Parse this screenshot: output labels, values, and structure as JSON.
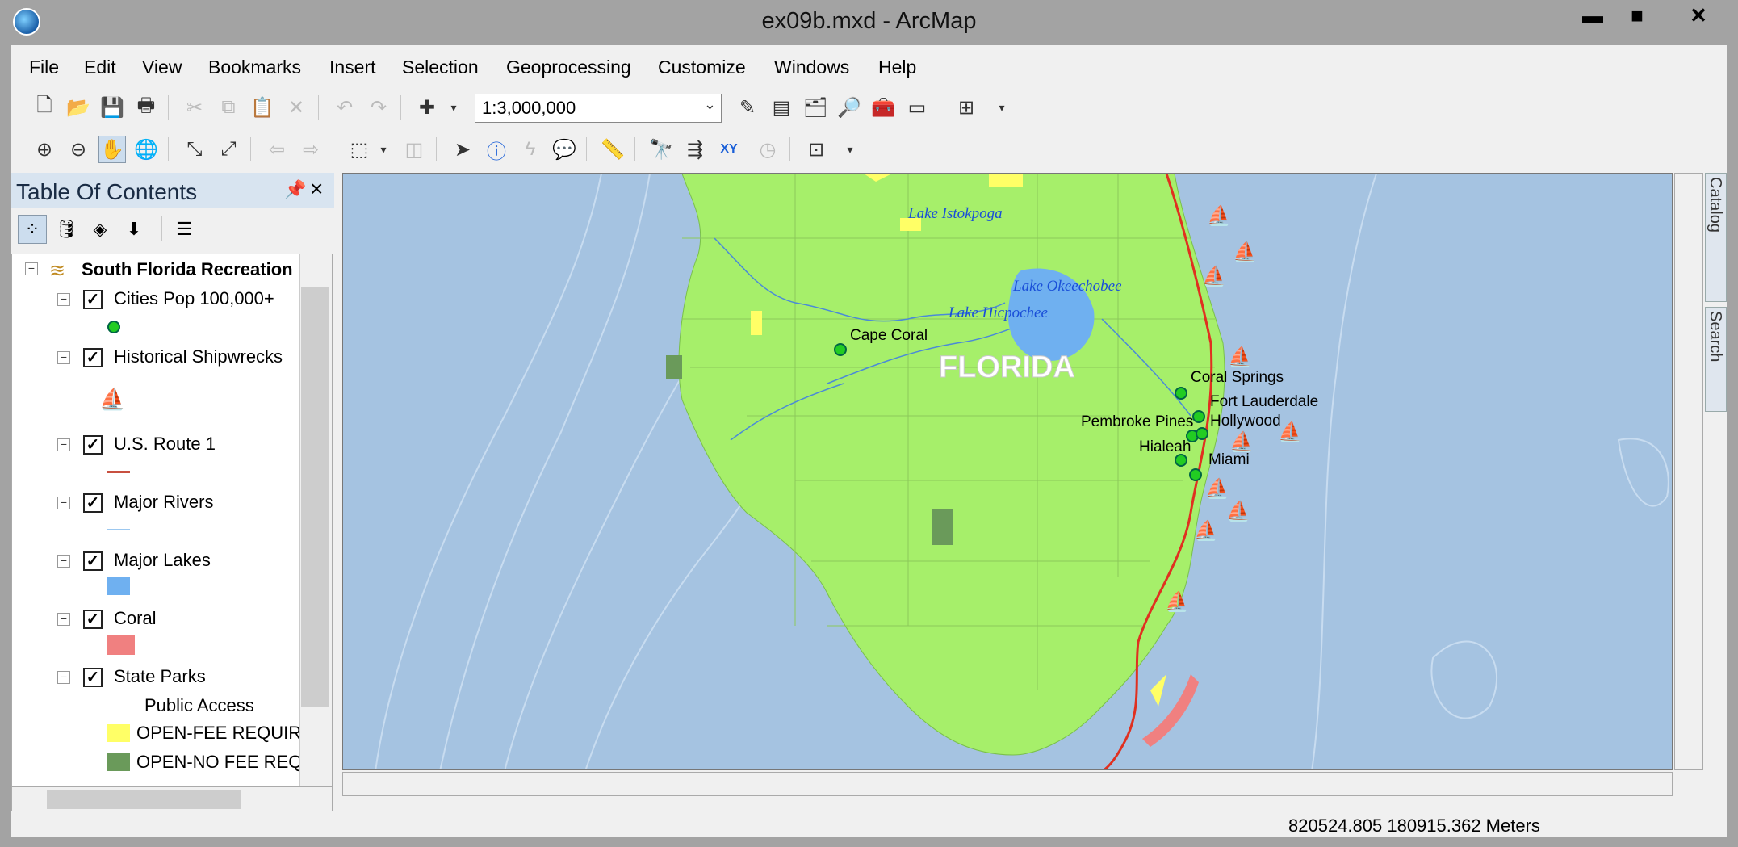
{
  "window": {
    "title": "ex09b.mxd - ArcMap",
    "minimize": "▬",
    "maximize": "■",
    "close": "✕"
  },
  "menu": [
    "File",
    "Edit",
    "View",
    "Bookmarks",
    "Insert",
    "Selection",
    "Geoprocessing",
    "Customize",
    "Windows",
    "Help"
  ],
  "toolbar": {
    "scale": "1:3,000,000"
  },
  "toc": {
    "title": "Table Of Contents",
    "root": "South Florida Recreation",
    "layers": [
      {
        "name": "Cities Pop 100,000+"
      },
      {
        "name": "Historical Shipwrecks"
      },
      {
        "name": "U.S. Route 1"
      },
      {
        "name": "Major Rivers"
      },
      {
        "name": "Major Lakes"
      },
      {
        "name": "Coral"
      },
      {
        "name": "State Parks"
      }
    ],
    "state_parks_field": "Public Access",
    "state_parks_classes": [
      "OPEN-FEE REQUIRE",
      "OPEN-NO FEE REQU"
    ]
  },
  "map": {
    "state_label": "FLORIDA",
    "lakes": [
      "Lake Istokpoga",
      "Lake Okeechobee",
      "Lake Hicpochee"
    ],
    "cities": [
      "Cape Coral",
      "Coral Springs",
      "Fort Lauderdale",
      "Pembroke Pines",
      "Hollywood",
      "Hialeah",
      "Miami"
    ]
  },
  "side_tabs": [
    "Catalog",
    "Search"
  ],
  "status": {
    "coordinates": "820524.805  180915.362 Meters"
  },
  "colors": {
    "land": "#a6ef6a",
    "water": "#a5c3e1",
    "lake": "#6fb0f0",
    "route": "#e03020",
    "coral": "#f08080",
    "park_fee": "#ffff66",
    "park_nofee": "#6a9a5a",
    "city": "#22aa22"
  },
  "icons": [
    "new-icon",
    "open-icon",
    "save-icon",
    "print-icon",
    "cut-icon",
    "copy-icon",
    "paste-icon",
    "delete-icon",
    "undo-icon",
    "redo-icon",
    "add-data-icon",
    "zoom-in-icon",
    "zoom-out-icon",
    "pan-icon",
    "full-extent-icon",
    "identify-icon",
    "find-icon",
    "go-to-xy-icon"
  ]
}
